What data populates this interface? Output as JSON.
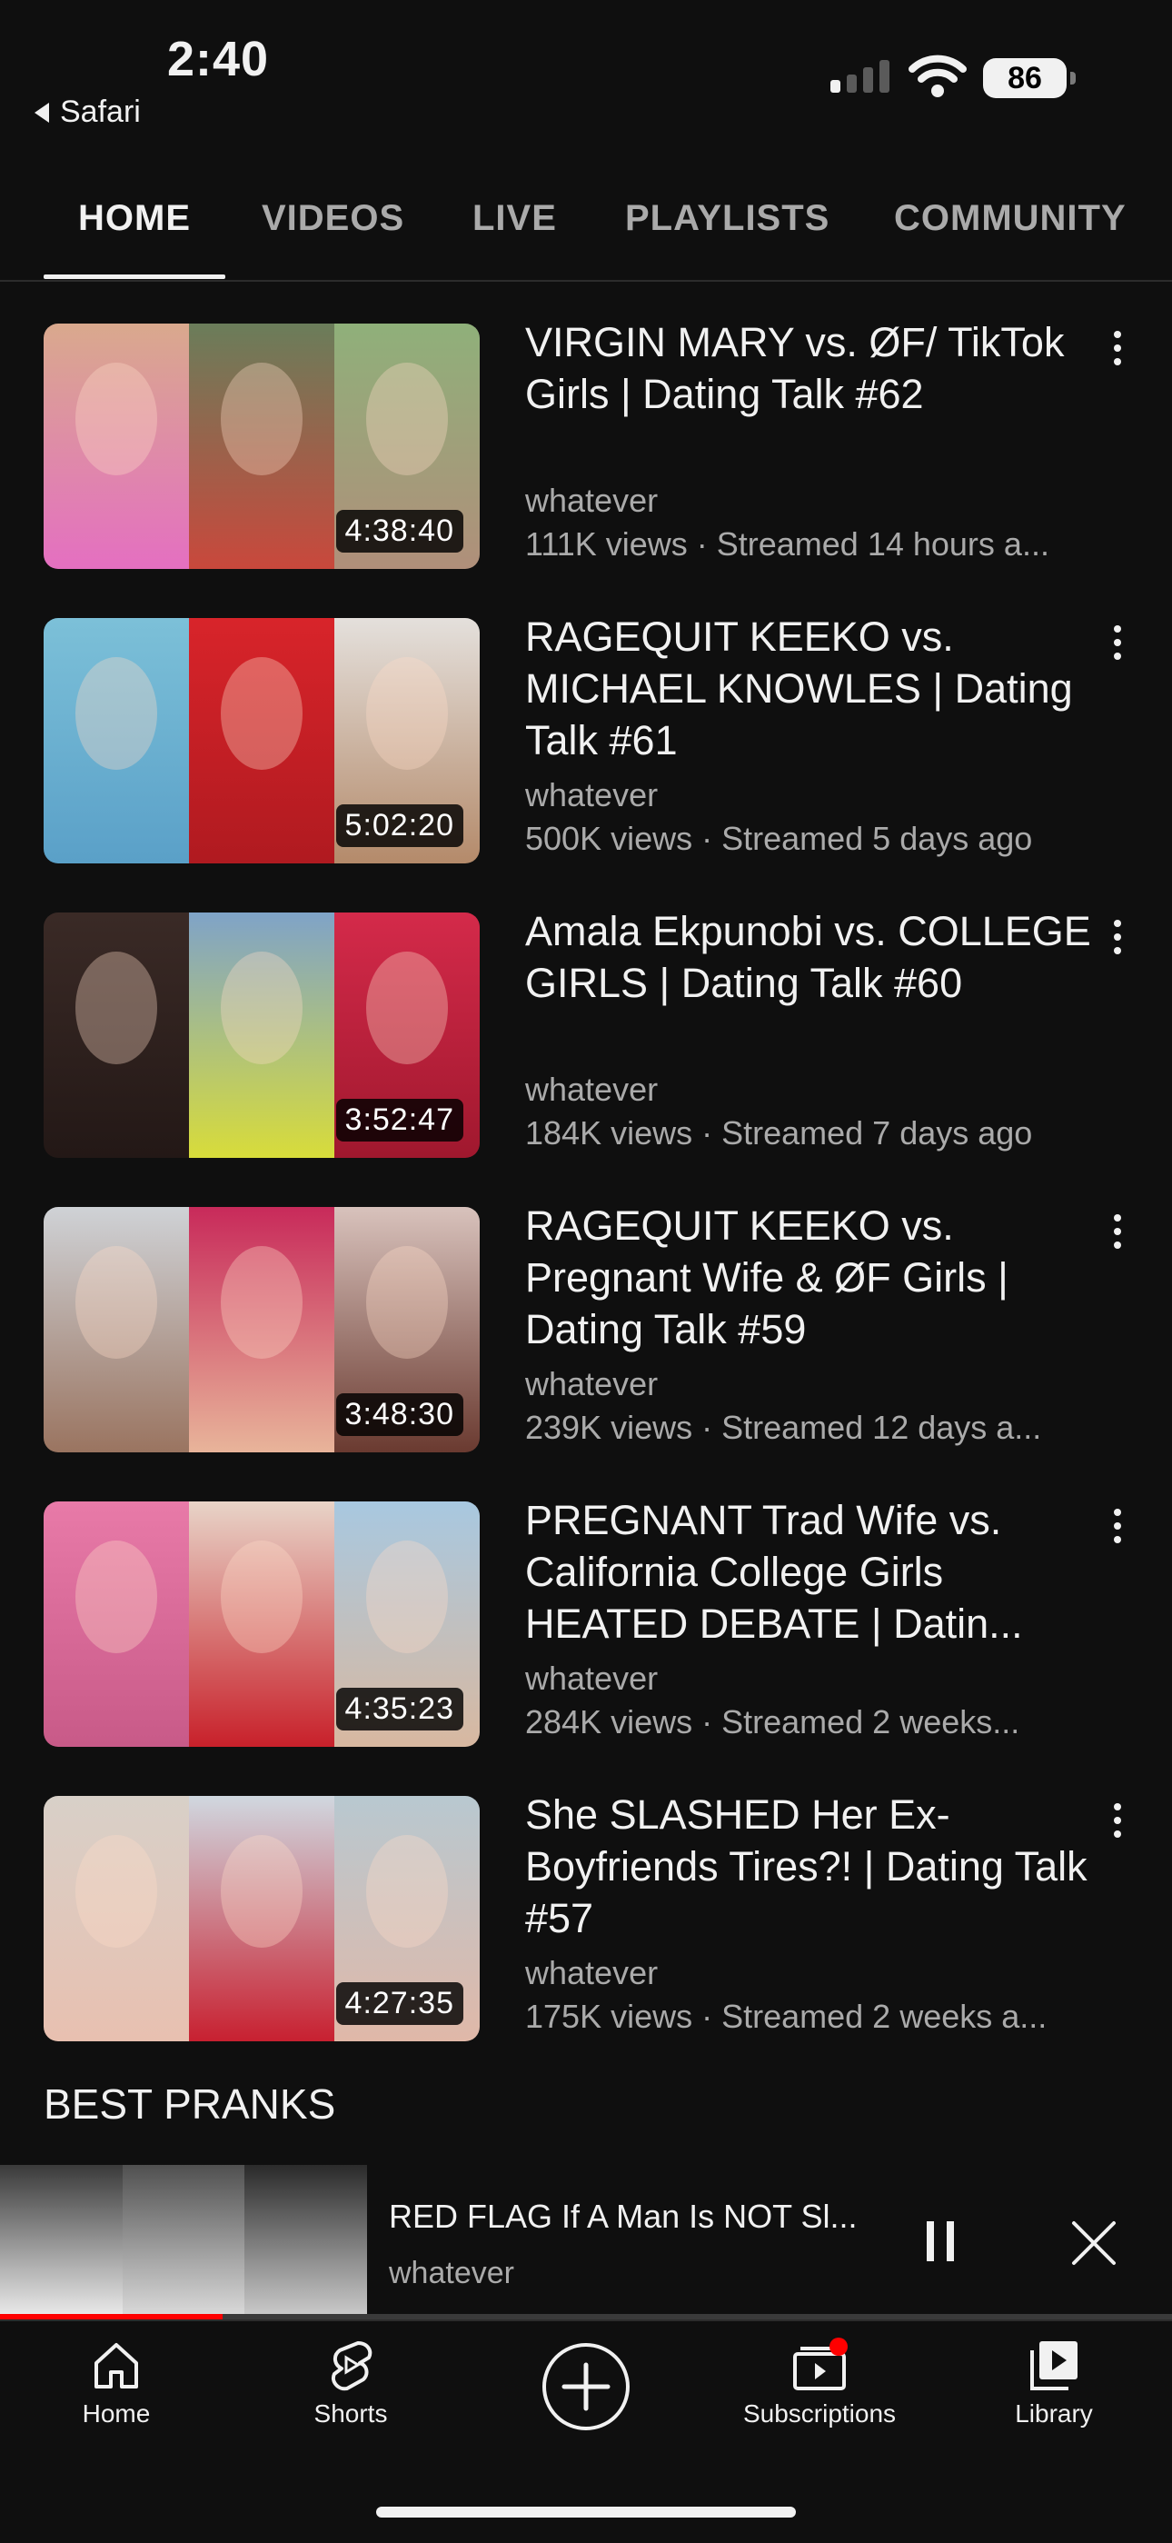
{
  "status": {
    "time": "2:40",
    "back_label": "Safari",
    "battery": "86"
  },
  "tabs": [
    "HOME",
    "VIDEOS",
    "LIVE",
    "PLAYLISTS",
    "COMMUNITY"
  ],
  "videos": [
    {
      "title": "VIRGIN MARY vs. ØF/ TikTok Girls | Dating Talk #62",
      "channel": "whatever",
      "meta": "111K views · Streamed 14 hours a...",
      "duration": "4:38:40"
    },
    {
      "title": "RAGEQUIT KEEKO vs. MICHAEL KNOWLES | Dating Talk #61",
      "channel": "whatever",
      "meta": "500K views · Streamed 5 days ago",
      "duration": "5:02:20"
    },
    {
      "title": "Amala Ekpunobi vs. COLLEGE GIRLS | Dating Talk #60",
      "channel": "whatever",
      "meta": "184K views · Streamed 7 days ago",
      "duration": "3:52:47"
    },
    {
      "title": "RAGEQUIT KEEKO vs. Pregnant Wife & ØF Girls | Dating Talk #59",
      "channel": "whatever",
      "meta": "239K views · Streamed 12 days a...",
      "duration": "3:48:30"
    },
    {
      "title": "PREGNANT Trad Wife vs. California College Girls HEATED DEBATE | Datin...",
      "channel": "whatever",
      "meta": "284K views · Streamed 2 weeks...",
      "duration": "4:35:23"
    },
    {
      "title": "She SLASHED Her Ex-Boyfriends Tires?! | Dating Talk #57",
      "channel": "whatever",
      "meta": "175K views · Streamed 2 weeks a...",
      "duration": "4:27:35"
    }
  ],
  "section_title": "BEST PRANKS",
  "mini_player": {
    "title": "RED FLAG If A Man Is NOT Sl...",
    "channel": "whatever",
    "progress": 0.19
  },
  "nav": {
    "home": "Home",
    "shorts": "Shorts",
    "subscriptions": "Subscriptions",
    "library": "Library"
  }
}
